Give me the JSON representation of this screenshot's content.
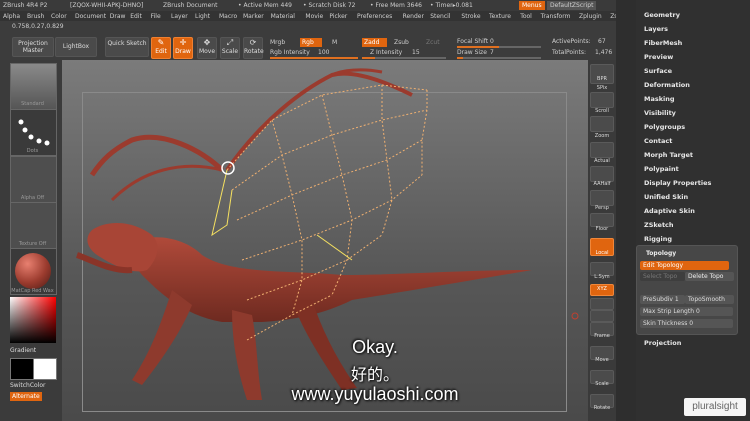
{
  "title_bar": {
    "app": "ZBrush 4R4 P2",
    "doc_id": "[ZQOX-WHII-APKJ-DHNO]",
    "doc": "ZBrush Document",
    "active_mem": "• Active Mem 449",
    "scratch": "• Scratch Disk 72",
    "free_mem": "• Free Mem 3646",
    "timer": "• Timer▸0.081",
    "menus_button": "Menus",
    "script": "DefaultZScript"
  },
  "menu_bar": [
    "Alpha",
    "Brush",
    "Color",
    "Document",
    "Draw",
    "Edit",
    "File",
    "Layer",
    "Light",
    "Macro",
    "Marker",
    "Material",
    "Movie",
    "Picker",
    "Preferences",
    "Render",
    "Stencil",
    "Stroke",
    "Texture",
    "Tool",
    "Transform",
    "Zplugin",
    "Zscript"
  ],
  "toolbar": {
    "coords": "0.758,0.27,0.829",
    "projection_master": "Projection Master",
    "lightbox": "LightBox",
    "quick_sketch": "Quick Sketch",
    "edit": "Edit",
    "draw": "Draw",
    "move": "Move",
    "scale": "Scale",
    "rotate": "Rotate",
    "mrgb": "Mrgb",
    "rgb": "Rgb",
    "m": "M",
    "rgb_intensity_label": "Rgb Intensity",
    "rgb_intensity": "100",
    "rgb_intensity_level": 1.0,
    "zadd": "Zadd",
    "zsub": "Zsub",
    "zcut": "Zcut",
    "z_intensity_label": "Z Intensity",
    "z_intensity": "15",
    "z_intensity_level": 0.15,
    "focal_shift_label": "Focal Shift",
    "focal_shift": "0",
    "focal_shift_level": 0.5,
    "draw_size_label": "Draw Size",
    "draw_size": "7",
    "draw_size_level": 0.07,
    "active_points_label": "ActivePoints:",
    "active_points": "67",
    "total_points_label": "TotalPoints:",
    "total_points": "1,476"
  },
  "left_panel": {
    "brush_label": "Standard",
    "stroke_label": "Dots",
    "alpha_label": "Alpha Off",
    "texture_label": "Texture Off",
    "material_label": "MatCap Red Wax",
    "gradient": "Gradient",
    "switch_color": "SwitchColor",
    "alternate": "Alternate"
  },
  "right_shelf": [
    "BPR",
    "SPix",
    "Scroll",
    "Zoom",
    "Actual",
    "AAHalf",
    "Persp",
    "Floor",
    "Local",
    "L.Sym",
    "XYZ",
    "",
    "",
    "Frame",
    "Move",
    "Scale",
    "Rotate"
  ],
  "tool_palette": {
    "items_top": [
      "Geometry",
      "Layers",
      "FiberMesh",
      "Preview",
      "Surface",
      "Deformation",
      "Masking",
      "Visibility",
      "Polygroups",
      "Contact",
      "Morph Target",
      "Polypaint",
      "Display Properties",
      "Unified Skin",
      "Adaptive Skin",
      "ZSketch",
      "Rigging"
    ],
    "topology": {
      "header": "Topology",
      "edit_topology": "Edit Topology",
      "select_topo": "Select Topo",
      "delete_topo": "Delete Topo",
      "presubdiv_label": "PreSubdiv",
      "presubdiv": "1",
      "topo_smooth": "TopoSmooth",
      "max_strip_label": "Max Strip Length",
      "max_strip": "0",
      "skin_thickness_label": "Skin Thickness",
      "skin_thickness": "0"
    },
    "projection": "Projection"
  },
  "subtitles": {
    "line1": "Okay.",
    "line2": "好的。",
    "line3": "www.yuyulaoshi.com"
  },
  "watermark": "pluralsight",
  "colors": {
    "accent": "#e0650f",
    "model": "#9b3b2e",
    "topology_lines": "#f0b070",
    "topology_highlight": "#f5e060"
  }
}
